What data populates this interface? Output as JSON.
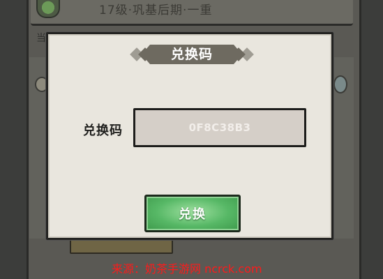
{
  "background": {
    "banner_text": "17级·巩基后期·一重",
    "side_label": "当"
  },
  "dialog": {
    "title": "兑换码",
    "field_label": "兑换码",
    "code_value": "0F8C38B3",
    "button_label": "兑换"
  },
  "watermark": "来源：奶茶手游网 ncrck.com",
  "colors": {
    "dialog_bg": "#e9e6de",
    "title_banner": "#6e6a60",
    "button_green": "#57b866",
    "watermark_red": "#ff1a1a"
  }
}
